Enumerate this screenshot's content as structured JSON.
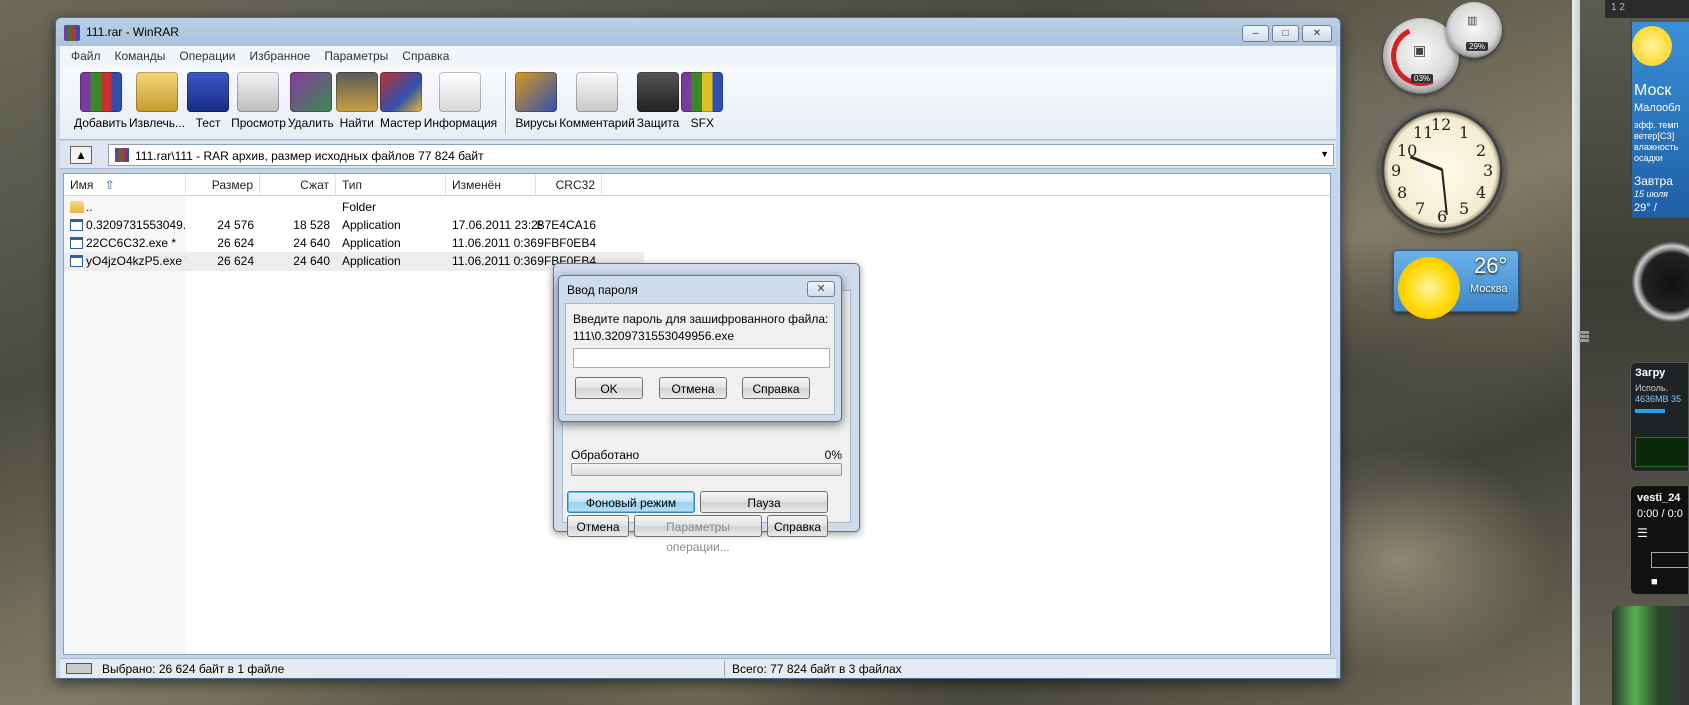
{
  "window": {
    "title": "111.rar - WinRAR",
    "caption": {
      "minimize": "–",
      "maximize": "□",
      "close": "✕"
    }
  },
  "menu": [
    "Файл",
    "Команды",
    "Операции",
    "Избранное",
    "Параметры",
    "Справка"
  ],
  "toolbar": {
    "add": "Добавить",
    "extract": "Извлечь...",
    "test": "Тест",
    "view": "Просмотр",
    "delete": "Удалить",
    "find": "Найти",
    "wizard": "Мастер",
    "info": "Информация",
    "virus": "Вирусы",
    "comment": "Комментарий",
    "protect": "Защита",
    "sfx": "SFX"
  },
  "address": {
    "path": "111.rar\\111 - RAR архив, размер исходных файлов 77 824 байт"
  },
  "columns": {
    "name": "Имя",
    "size": "Размер",
    "packed": "Сжат",
    "type": "Тип",
    "modified": "Изменён",
    "crc": "CRC32"
  },
  "files": [
    {
      "name": "..",
      "size": "",
      "packed": "",
      "type": "Folder",
      "modified": "",
      "crc": ""
    },
    {
      "name": "0.3209731553049...",
      "size": "24 576",
      "packed": "18 528",
      "type": "Application",
      "modified": "17.06.2011 23:29",
      "crc": "B7E4CA16"
    },
    {
      "name": "22CC6C32.exe *",
      "size": "26 624",
      "packed": "24 640",
      "type": "Application",
      "modified": "11.06.2011 0:36",
      "crc": "9FBF0EB4"
    },
    {
      "name": "yO4jzO4kzP5.exe *",
      "size": "26 624",
      "packed": "24 640",
      "type": "Application",
      "modified": "11.06.2011 0:36",
      "crc": "9FBF0EB4"
    }
  ],
  "status": {
    "selected": "Выбрано: 26 624 байт в 1 файле",
    "total": "Всего: 77 824 байт в 3 файлах"
  },
  "progress_dialog": {
    "processed_label": "Обработано",
    "processed_pct": "0%",
    "progress_fraction": 0,
    "background_btn": "Фоновый режим",
    "pause_btn": "Пауза",
    "cancel_btn": "Отмена",
    "options_btn": "Параметры операции...",
    "help_btn": "Справка"
  },
  "password_dialog": {
    "title": "Ввод пароля",
    "prompt": "Введите пароль для зашифрованного файла:",
    "file": "111\\0.3209731553049956.exe",
    "input_value": "",
    "ok_btn": "OK",
    "cancel_btn": "Отмена",
    "help_btn": "Справка"
  },
  "gadgets": {
    "cpu_pct": "03%",
    "ram_pct": "29%",
    "weather_temp": "26°",
    "weather_city": "Москва",
    "panel_weather": {
      "city": "Моск",
      "cond": "Малообл",
      "l1": "эфф. темп",
      "l2": "ветер[СЗ]",
      "l3": "влажность",
      "l4": "осадки",
      "tomorrow": "Завтра",
      "date": "15 июля",
      "temps": "29° / "
    },
    "net": {
      "title": "Загру",
      "l1": "Исполь.",
      "l2": "4636MB  35"
    },
    "player": {
      "title": "vesti_24",
      "time": "0:00 / 0:0"
    },
    "topstrip": "1   2"
  }
}
